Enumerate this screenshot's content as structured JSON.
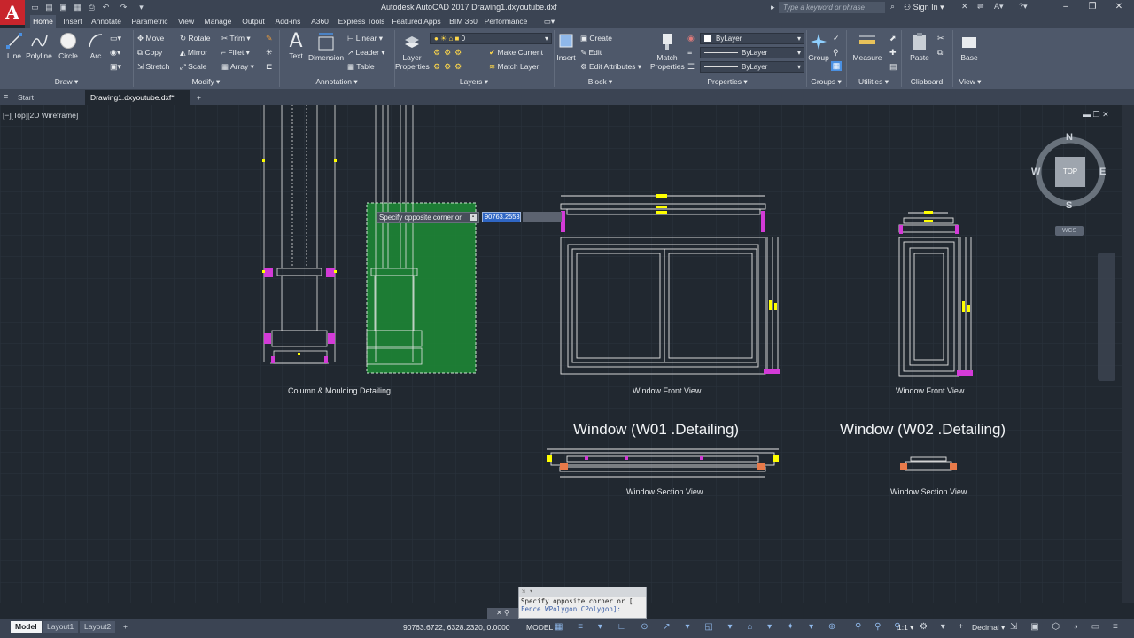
{
  "titlebar": {
    "logo": "A",
    "title": "Autodesk AutoCAD 2017    Drawing1.dxyoutube.dxf",
    "search_placeholder": "Type a keyword or phrase",
    "sign_in": "Sign In",
    "minimize": "–",
    "restore": "❐",
    "close": "✕"
  },
  "ribbon_tabs": [
    "Home",
    "Insert",
    "Annotate",
    "Parametric",
    "View",
    "Manage",
    "Output",
    "Add-ins",
    "A360",
    "Express Tools",
    "Featured Apps",
    "BIM 360",
    "Performance"
  ],
  "ribbon": {
    "draw": {
      "line": "Line",
      "polyline": "Polyline",
      "circle": "Circle",
      "arc": "Arc",
      "panel": "Draw ▾"
    },
    "modify": {
      "move": "Move",
      "rotate": "Rotate",
      "trim": "Trim",
      "copy": "Copy",
      "mirror": "Mirror",
      "fillet": "Fillet",
      "stretch": "Stretch",
      "scale": "Scale",
      "array": "Array",
      "panel": "Modify ▾"
    },
    "annotation": {
      "text": "Text",
      "dimension": "Dimension",
      "linear": "Linear",
      "leader": "Leader",
      "table": "Table",
      "panel": "Annotation ▾"
    },
    "layers": {
      "layer_properties_1": "Layer",
      "layer_properties_2": "Properties",
      "current_layer": "0",
      "make_current": "Make Current",
      "match_layer": "Match Layer",
      "panel": "Layers ▾"
    },
    "block": {
      "insert": "Insert",
      "create": "Create",
      "edit": "Edit",
      "edit_attributes": "Edit Attributes",
      "panel": "Block ▾"
    },
    "properties": {
      "match_1": "Match",
      "match_2": "Properties",
      "color": "ByLayer",
      "linetype": "ByLayer",
      "lineweight": "ByLayer",
      "panel": "Properties ▾"
    },
    "groups": {
      "group": "Group",
      "panel": "Groups ▾"
    },
    "utilities": {
      "measure": "Measure",
      "panel": "Utilities ▾"
    },
    "clipboard": {
      "paste": "Paste",
      "panel": "Clipboard"
    },
    "view": {
      "base": "Base",
      "panel": "View ▾"
    }
  },
  "doc_tabs": {
    "start": "Start",
    "drawing": "Drawing1.dxyoutube.dxf*",
    "new": "+"
  },
  "viewport": {
    "label": "[−][Top][2D Wireframe]",
    "compass": {
      "n": "N",
      "s": "S",
      "e": "E",
      "w": "W",
      "top": "TOP"
    },
    "wcs": "WCS"
  },
  "drawing_labels": {
    "column": "Column  & Moulding Detailing",
    "front1": "Window Front View",
    "front2": "Window Front View",
    "title1": "Window (W01 .Detailing)",
    "title2": "Window (W02 .Detailing)",
    "section1": "Window Section View",
    "section2": "Window Section View"
  },
  "prompt": {
    "tooltip": "Specify opposite corner or",
    "coord": "90763.2553"
  },
  "command": {
    "history": "Specify opposite corner or [",
    "input": "Fence WPolygon CPolygon]:"
  },
  "status": {
    "model_tab": "Model",
    "layout1": "Layout1",
    "layout2": "Layout2",
    "add": "+",
    "coords": "90763.6722, 6328.2320, 0.0000",
    "model": "MODEL",
    "scale": "1:1 ▾",
    "units": "Decimal ▾"
  },
  "colors": {
    "selection": "#1c8b35",
    "accent": "#c8252c",
    "grip": "#ffff00",
    "magenta": "#e040e0"
  }
}
